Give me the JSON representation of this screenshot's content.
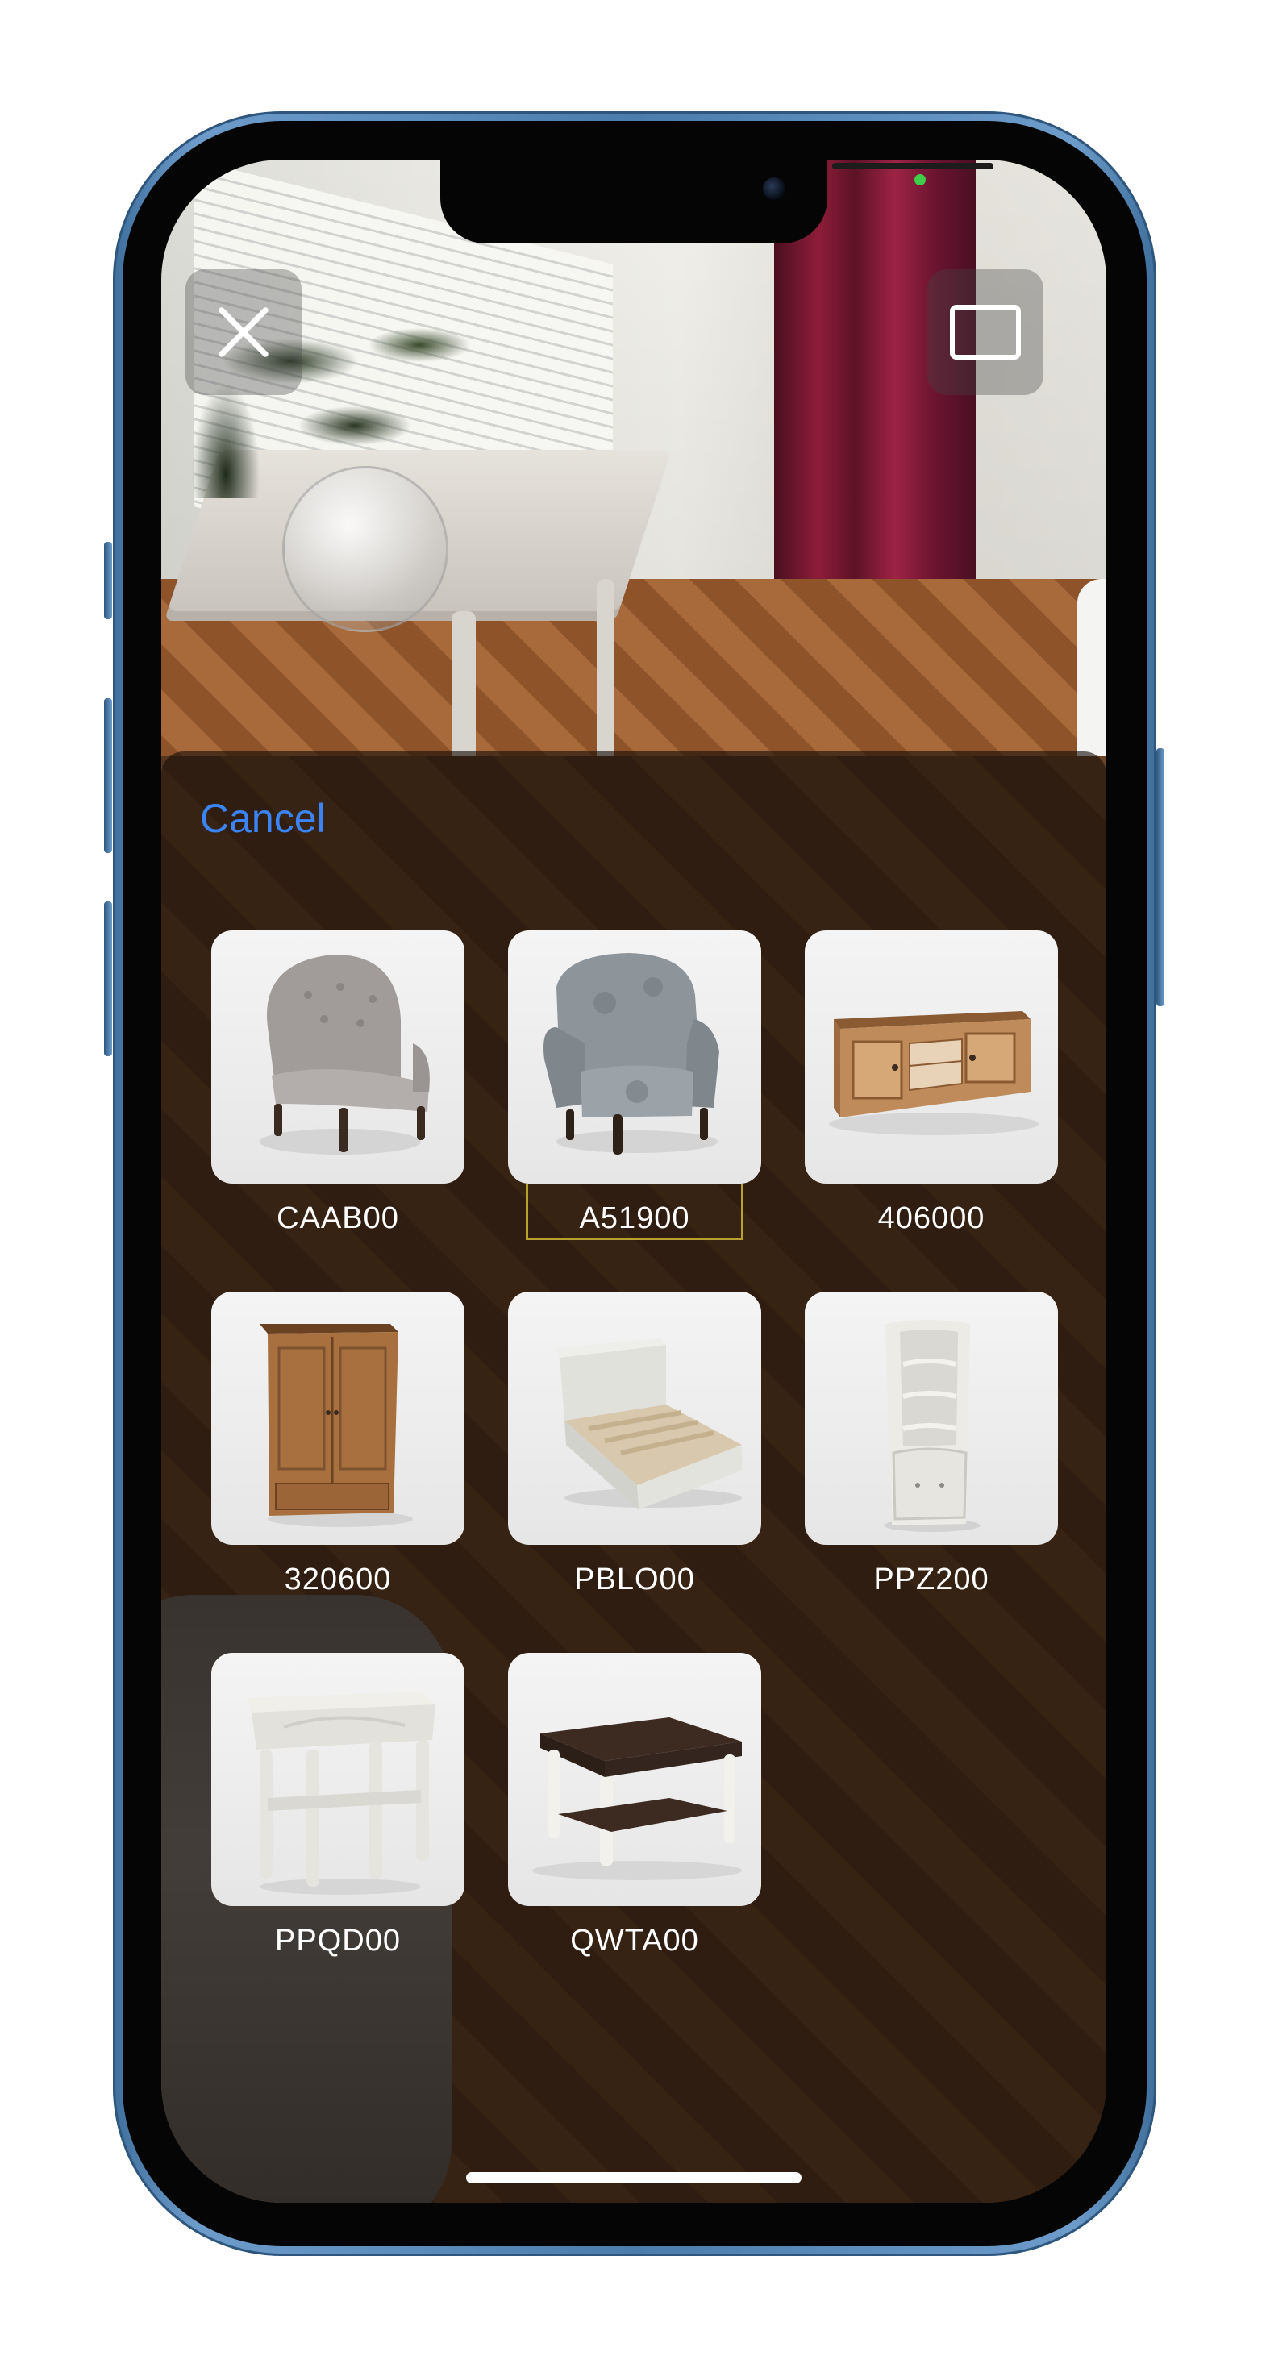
{
  "camera_controls": {
    "close": "close-icon",
    "frame": "frame-icon"
  },
  "sheet": {
    "cancel_label": "Cancel",
    "items": [
      {
        "label": "CAAB00",
        "icon": "tufted-armchair-icon",
        "selected": false
      },
      {
        "label": "A51900",
        "icon": "floral-armchair-icon",
        "selected": true
      },
      {
        "label": "406000",
        "icon": "tv-cabinet-icon",
        "selected": false
      },
      {
        "label": "320600",
        "icon": "wardrobe-icon",
        "selected": false
      },
      {
        "label": "PBLO00",
        "icon": "single-bed-icon",
        "selected": false
      },
      {
        "label": "PPZ200",
        "icon": "corner-shelf-icon",
        "selected": false
      },
      {
        "label": "PPQD00",
        "icon": "side-table-icon",
        "selected": false
      },
      {
        "label": "QWTA00",
        "icon": "coffee-table-icon",
        "selected": false
      }
    ]
  },
  "colors": {
    "accent": "#3a84f5",
    "frame": "#4a7cac",
    "selection": "#b9a12e",
    "privacy_indicator": "#3ecf4a"
  }
}
